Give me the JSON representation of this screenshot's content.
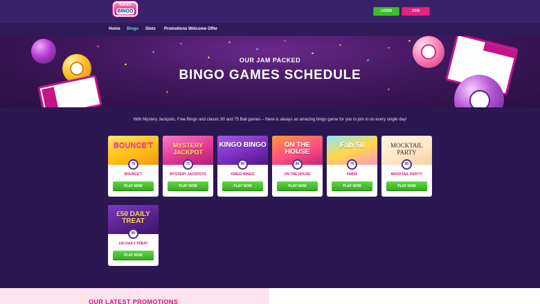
{
  "brand": {
    "logo_top": "Safari",
    "logo_bottom": "BINGO"
  },
  "header": {
    "login_label": "LOGIN",
    "join_label": "JOIN"
  },
  "nav": {
    "items": [
      {
        "label": "Home"
      },
      {
        "label": "Bingo"
      },
      {
        "label": "Slots"
      },
      {
        "label": "Promotions"
      },
      {
        "label": "Welcome Offer"
      }
    ],
    "active": "Bingo"
  },
  "hero": {
    "kicker": "OUR JAM PACKED",
    "title": "BINGO GAMES SCHEDULE"
  },
  "intro": "With Mystery Jackpots, Free Bingo and classic 90 and 75 Ball games – there is always an amazing bingo game for you to join in on every single day!",
  "games": [
    {
      "art_text": "BOUNCE'T",
      "balls": "75",
      "name": "BOUNCE'T",
      "play_label": "PLAY NOW"
    },
    {
      "art_text": "MYSTERY JACKPOT",
      "balls": "70",
      "name": "MYSTERY JACKPOTS",
      "play_label": "PLAY NOW"
    },
    {
      "art_text": "KINGO BINGO",
      "balls": "90",
      "name": "KINGO BINGO",
      "play_label": "PLAY NOW"
    },
    {
      "art_text": "ON THE HOUSE",
      "balls": "90",
      "name": "ON THE HOUSE",
      "play_label": "PLAY NOW"
    },
    {
      "art_text": "Fab 50",
      "balls": "75",
      "name": "FAB50",
      "play_label": "PLAY NOW"
    },
    {
      "art_text": "MOCKTAIL PARTY",
      "balls": "90",
      "name": "MOCKTAIL PARTY!",
      "play_label": "PLAY NOW"
    },
    {
      "art_text": "£50 DAILY TREAT",
      "balls": "90",
      "name": "£50 DAILY TREAT",
      "play_label": "PLAY NOW"
    }
  ],
  "promotions": {
    "title": "OUR LATEST PROMOTIONS"
  },
  "colors": {
    "accent_pink": "#e8207e",
    "accent_green": "#3cbf2c",
    "page_bg": "#2b1752",
    "nav_active": "#66d7f0"
  }
}
